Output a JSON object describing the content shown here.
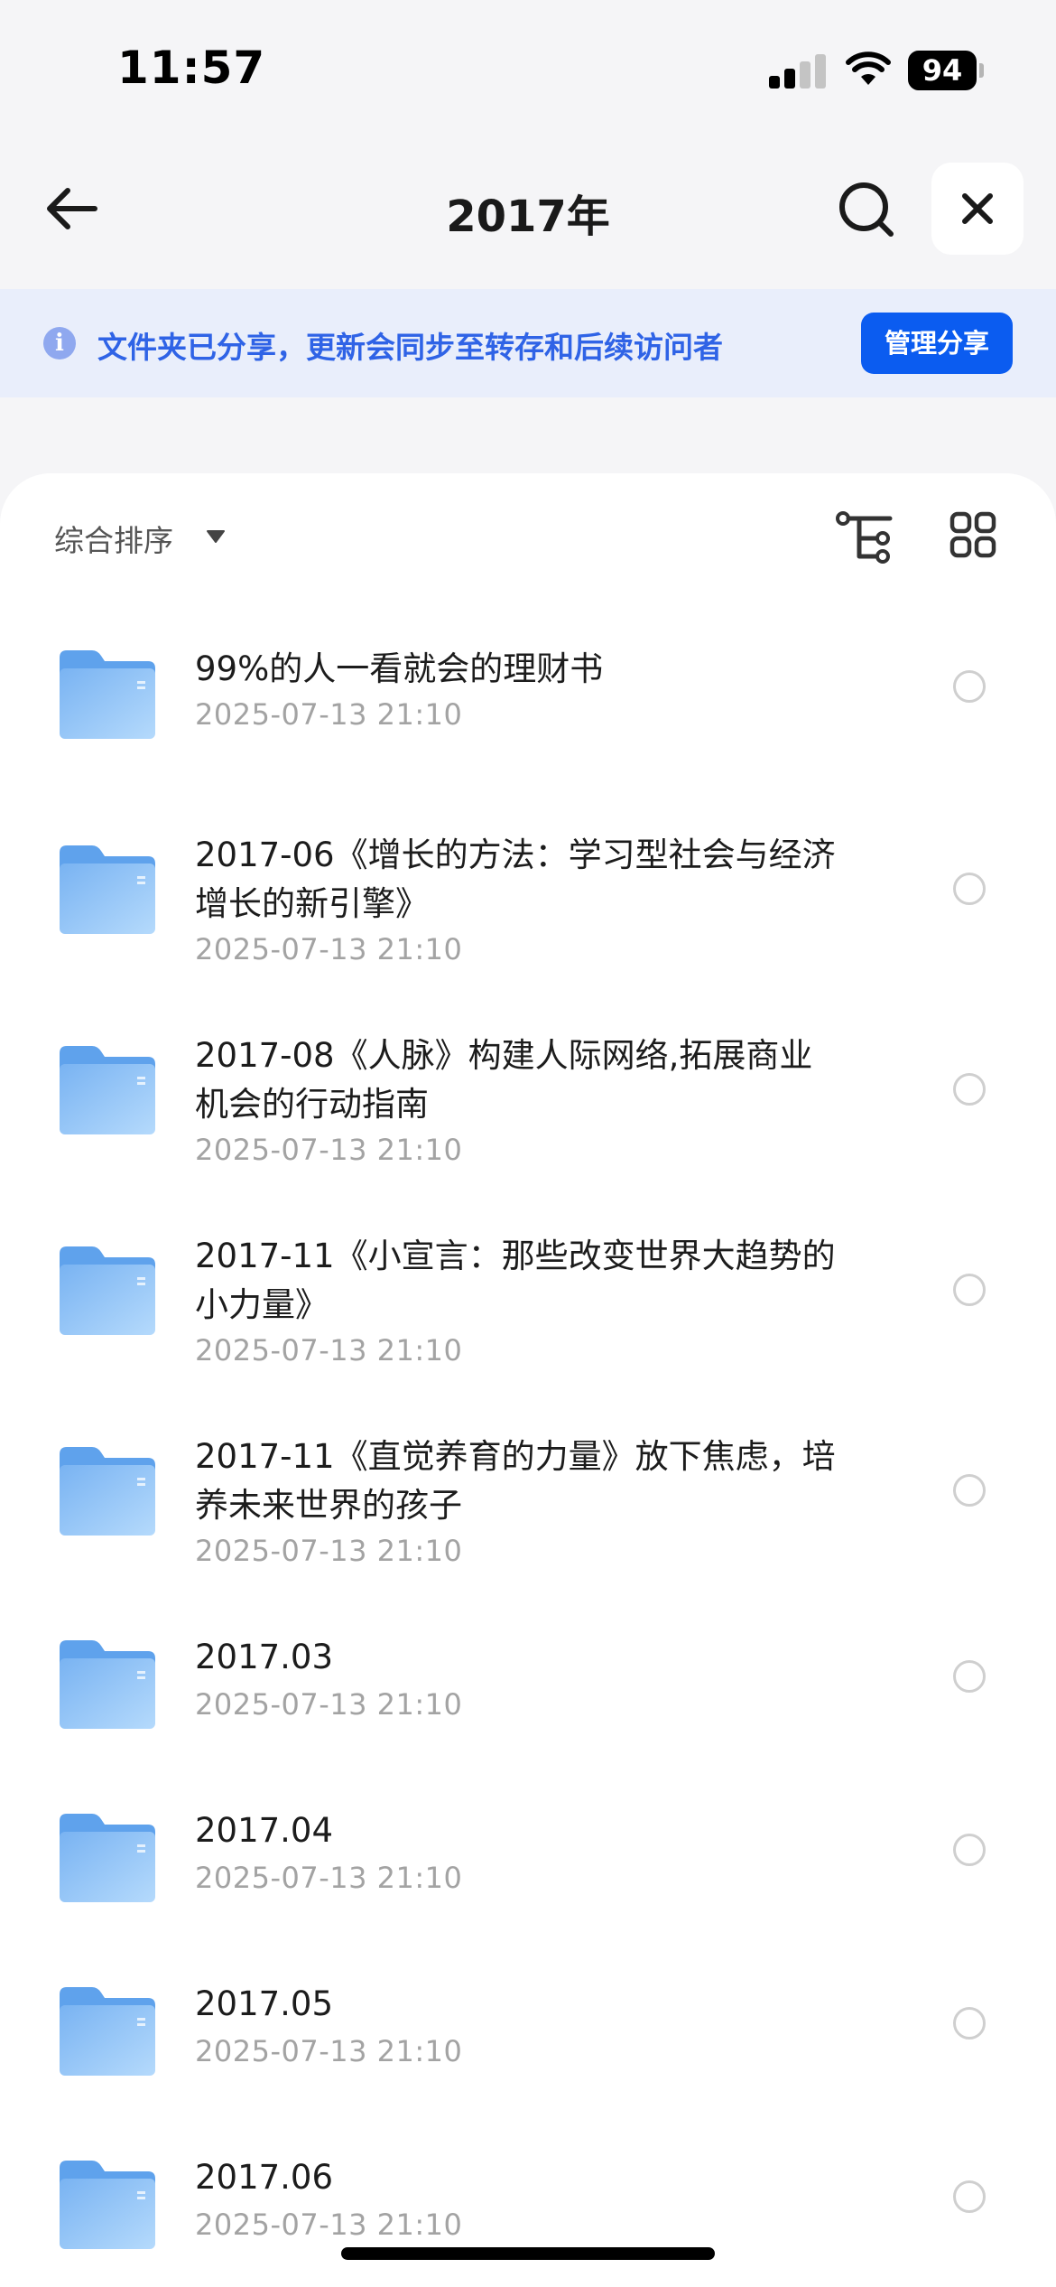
{
  "status_bar": {
    "time": "11:57",
    "battery": "94"
  },
  "nav": {
    "title": "2017年",
    "back_icon": "arrow-left-icon",
    "search_icon": "search-icon",
    "close_icon": "close-icon"
  },
  "banner": {
    "info_icon": "info-icon",
    "info_glyph": "i",
    "text": "文件夹已分享，更新会同步至转存和后续访问者",
    "button_label": "管理分享"
  },
  "toolbar": {
    "sort_label": "综合排序"
  },
  "files": [
    {
      "name": "99%的人一看就会的理财书",
      "date": "2025-07-13 21:10"
    },
    {
      "name": "2017-06《增长的方法：学习型社会与经济增长的新引擎》",
      "date": "2025-07-13 21:10"
    },
    {
      "name": "2017-08《人脉》构建人际网络,拓展商业机会的行动指南",
      "date": "2025-07-13 21:10"
    },
    {
      "name": "2017-11《小宣言：那些改变世界大趋势的小力量》",
      "date": "2025-07-13 21:10"
    },
    {
      "name": "2017-11《直觉养育的力量》放下焦虑，培养未来世界的孩子",
      "date": "2025-07-13 21:10"
    },
    {
      "name": "2017.03",
      "date": "2025-07-13 21:10"
    },
    {
      "name": "2017.04",
      "date": "2025-07-13 21:10"
    },
    {
      "name": "2017.05",
      "date": "2025-07-13 21:10"
    },
    {
      "name": "2017.06",
      "date": "2025-07-13 21:10"
    }
  ],
  "colors": {
    "accent": "#0b5cf0",
    "banner_bg": "#e9eefb",
    "banner_text": "#2f63e6",
    "folder": "#8ec3f7"
  }
}
